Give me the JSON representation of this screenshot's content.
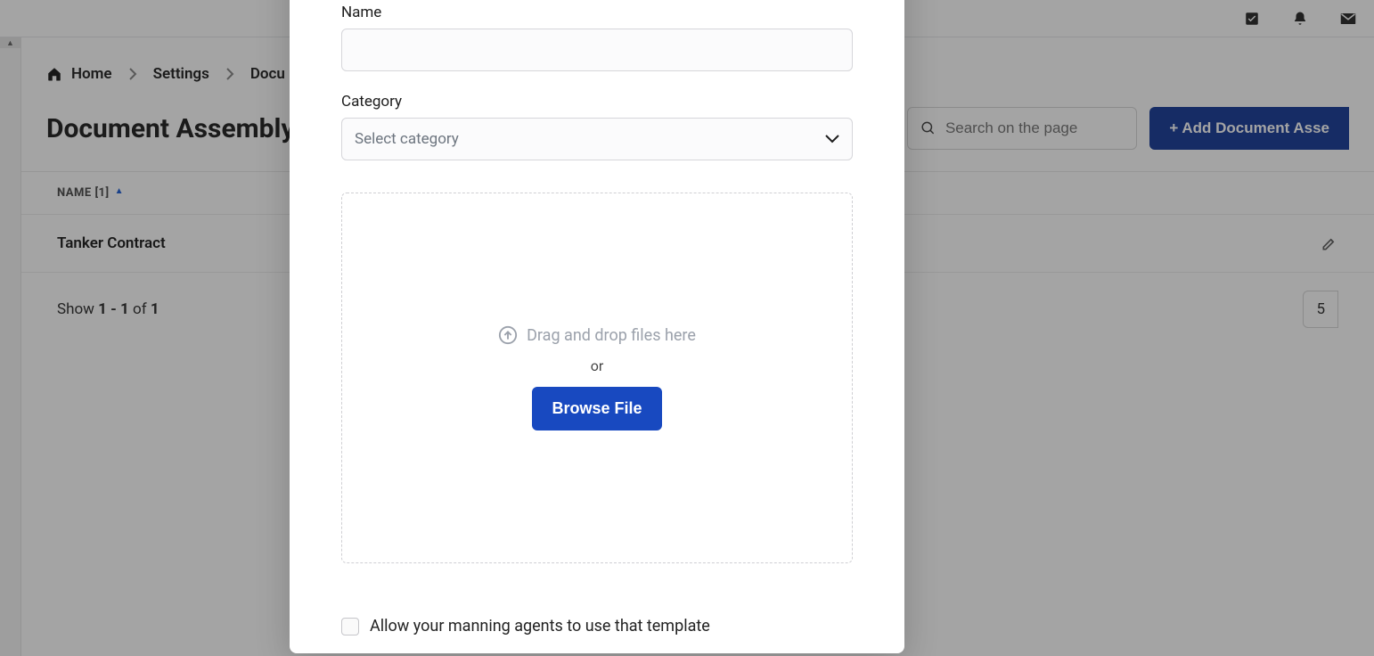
{
  "topbar": {
    "icons": [
      "check-square",
      "bell",
      "mail"
    ]
  },
  "breadcrumb": {
    "items": [
      "Home",
      "Settings",
      "Docu"
    ]
  },
  "page": {
    "title": "Document Assembly"
  },
  "search": {
    "placeholder": "Search on the page"
  },
  "buttons": {
    "add": "+ Add Document Asse",
    "browse": "Browse File"
  },
  "table": {
    "column_header": "NAME [1]",
    "rows": [
      {
        "name": "Tanker Contract"
      }
    ],
    "footer_prefix": "Show ",
    "footer_range": "1 - 1",
    "footer_mid": " of ",
    "footer_total": "1",
    "page_size": "5"
  },
  "modal": {
    "name_label": "Name",
    "category_label": "Category",
    "category_placeholder": "Select category",
    "drop_text": "Drag and drop files here",
    "or_text": "or",
    "allow_label": "Allow your manning agents to use that template"
  }
}
